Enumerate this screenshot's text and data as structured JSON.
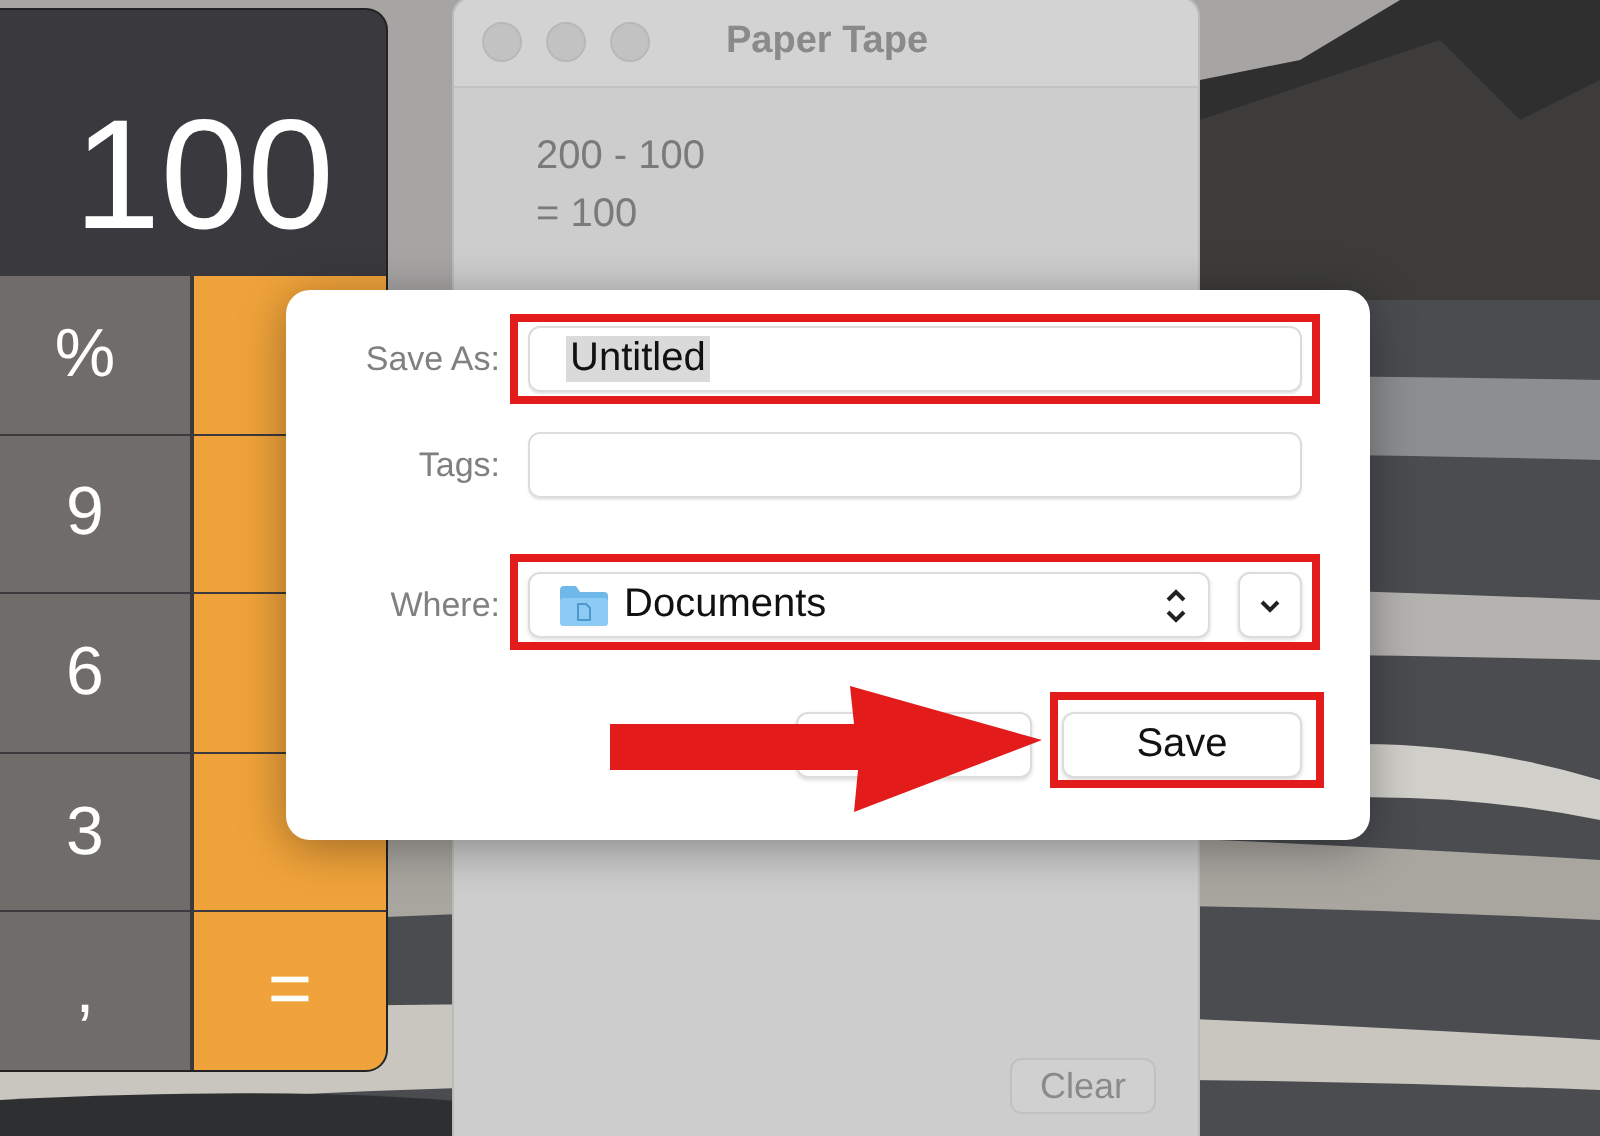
{
  "calculator": {
    "display": "100",
    "keys": [
      {
        "label": "%",
        "kind": "function"
      },
      {
        "kind": "operator"
      },
      {
        "label": "9",
        "kind": "digit"
      },
      {
        "kind": "operator"
      },
      {
        "label": "6",
        "kind": "digit"
      },
      {
        "kind": "operator"
      },
      {
        "label": "3",
        "kind": "digit"
      },
      {
        "kind": "operator"
      },
      {
        "label": ",",
        "kind": "digit"
      },
      {
        "label": "=",
        "kind": "operator"
      }
    ]
  },
  "paper_tape": {
    "title": "Paper Tape",
    "lines": [
      "200 - 100",
      "= 100"
    ],
    "clear_button": "Clear"
  },
  "save_dialog": {
    "save_as": {
      "label": "Save As:",
      "value": "Untitled",
      "value_selected": true
    },
    "tags": {
      "label": "Tags:"
    },
    "where": {
      "label": "Where:",
      "value": "Documents"
    },
    "buttons": [
      {
        "kind": "cancel"
      },
      {
        "kind": "default",
        "label": "Save"
      }
    ]
  }
}
